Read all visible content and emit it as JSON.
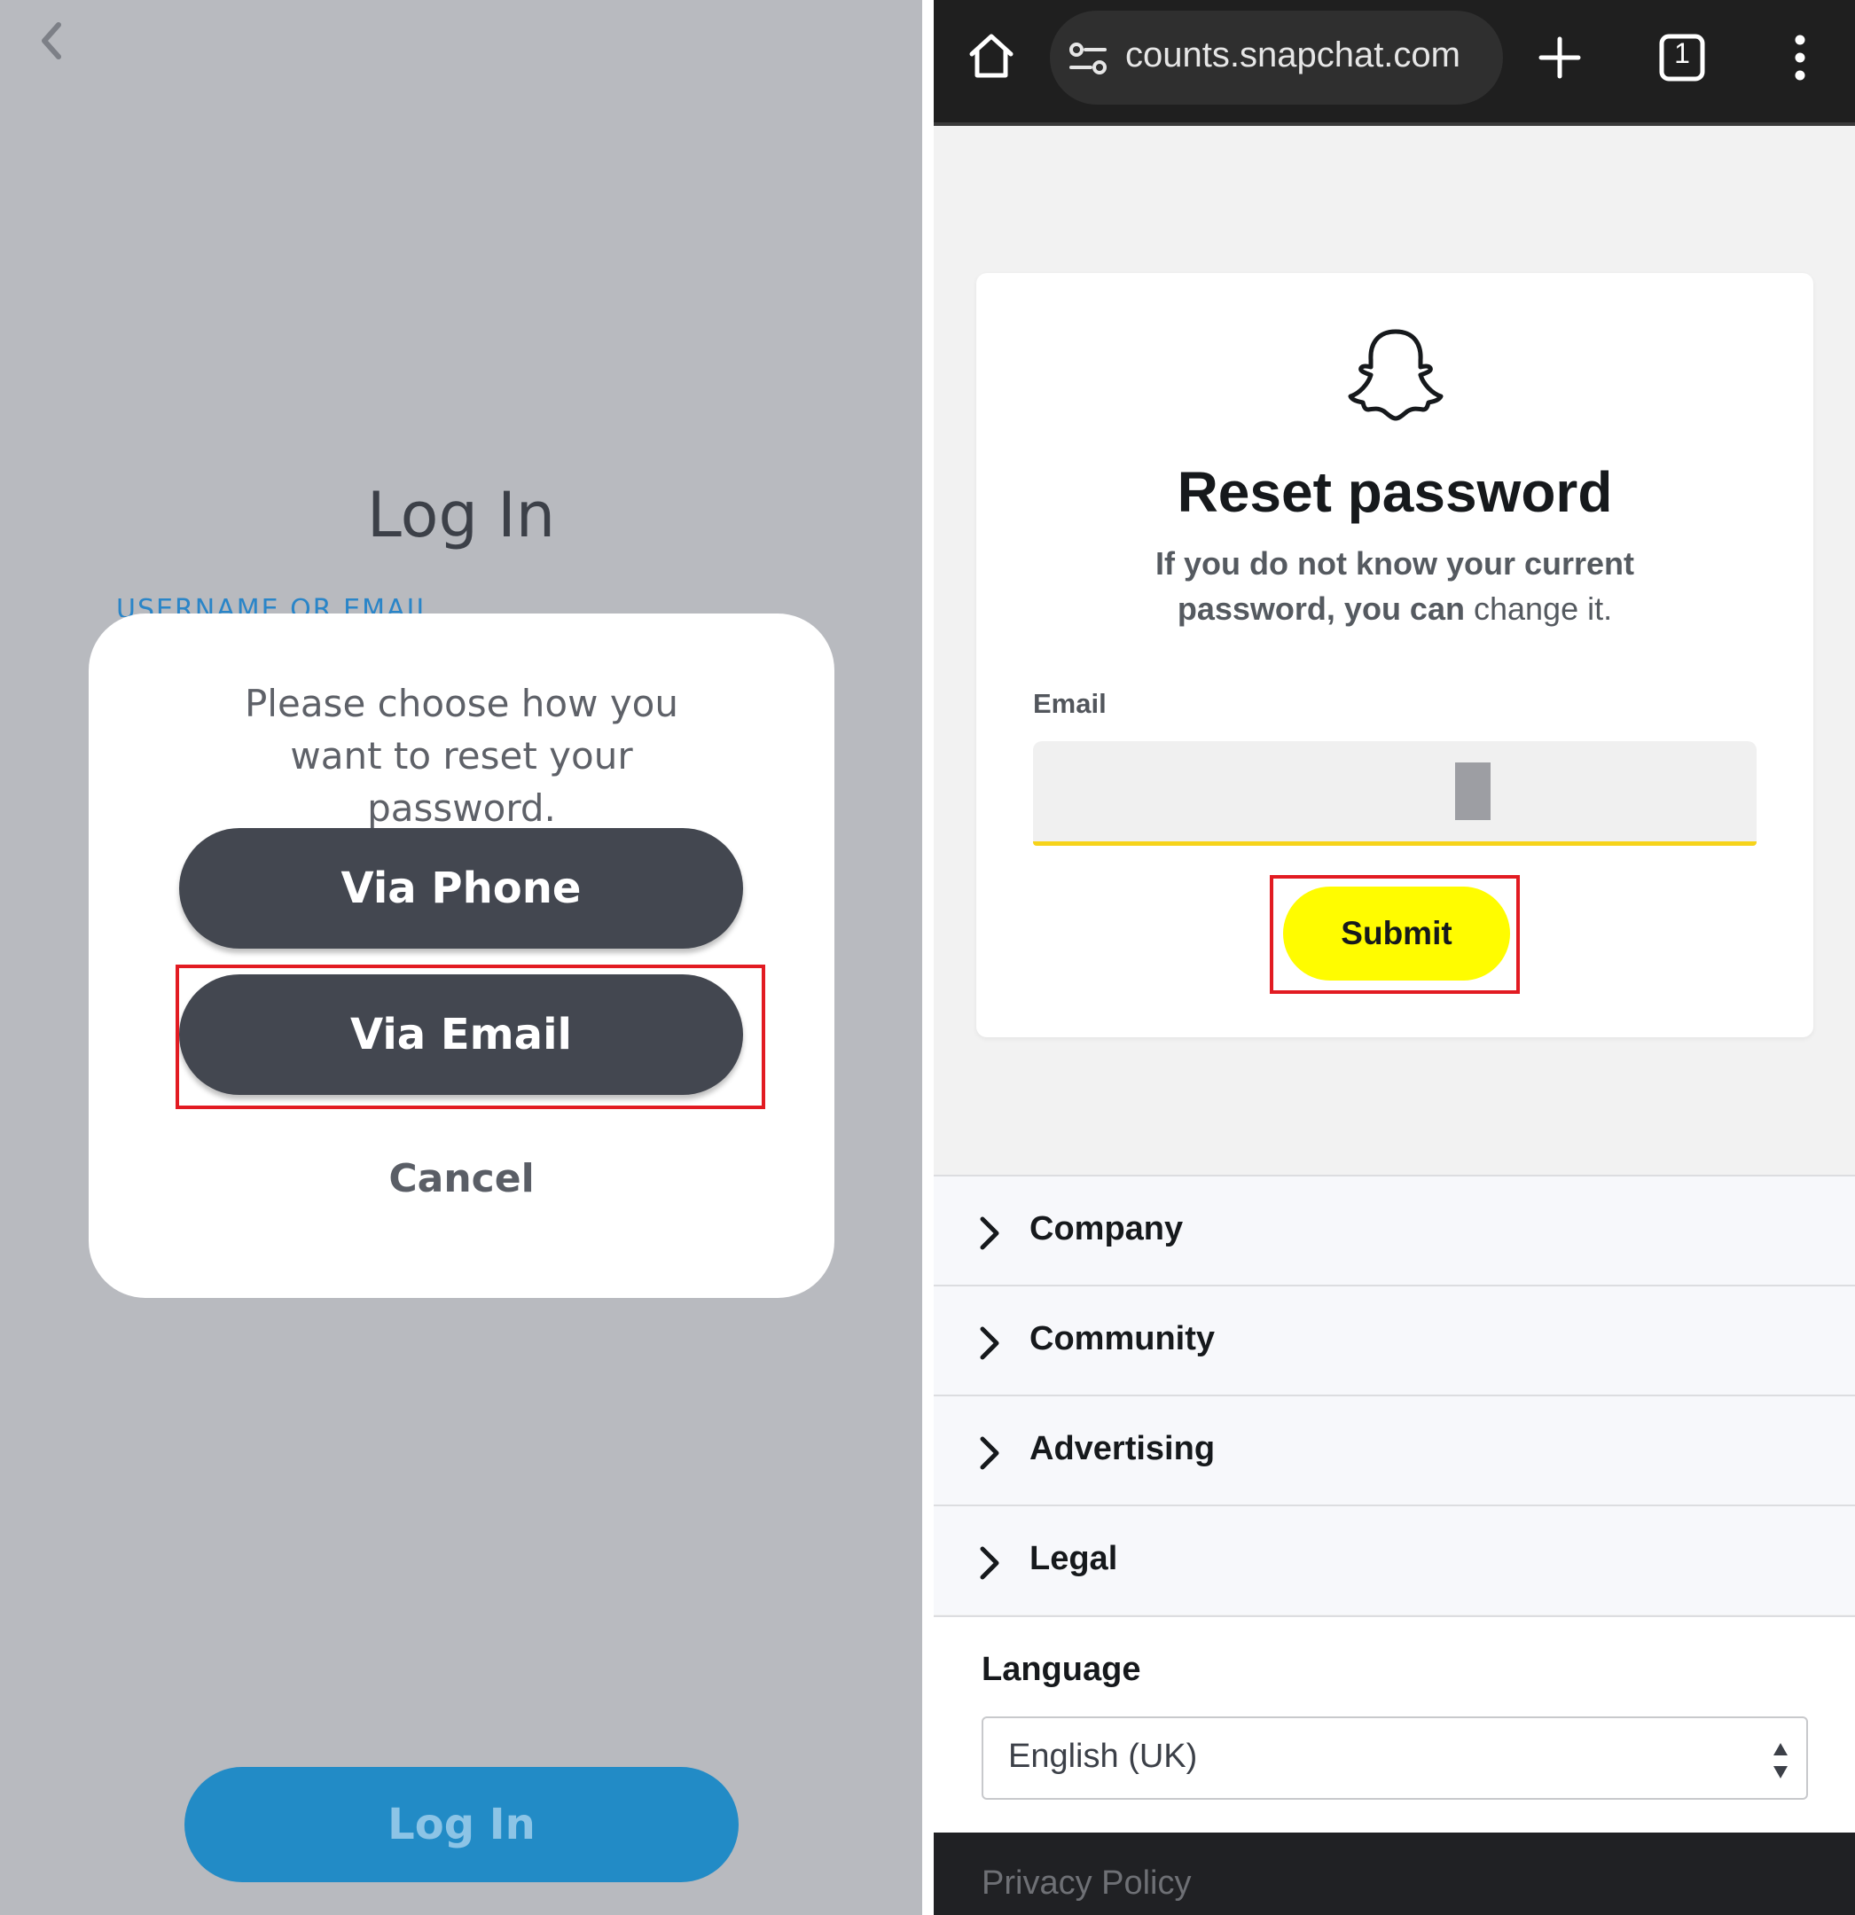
{
  "left_panel": {
    "title": "Log In",
    "username_label": "USERNAME OR EMAIL",
    "modal": {
      "message": "Please choose how you want to reset your password.",
      "via_phone_label": "Via Phone",
      "via_email_label": "Via Email",
      "cancel_label": "Cancel"
    },
    "login_button_label": "Log In"
  },
  "browser": {
    "url": "counts.snapchat.com",
    "tab_count": "1"
  },
  "reset_card": {
    "title": "Reset password",
    "subtitle_bold": "If you do not know your current password, you can",
    "subtitle_link": "change it.",
    "email_label": "Email",
    "email_value": "",
    "submit_label": "Submit"
  },
  "footer": {
    "items": [
      {
        "label": "Company"
      },
      {
        "label": "Community"
      },
      {
        "label": "Advertising"
      },
      {
        "label": "Legal"
      }
    ],
    "language_label": "Language",
    "language_value": "English (UK)",
    "privacy_label": "Privacy Policy"
  },
  "colors": {
    "left_bg": "#b8babf",
    "pill_button": "#434750",
    "login_blue": "#228bc6",
    "snap_yellow": "#fffc00",
    "highlight_red": "#e21b22"
  },
  "icons": [
    "back-icon",
    "home-icon",
    "site-settings-icon",
    "plus-icon",
    "tabs-icon",
    "menu-icon",
    "ghost-logo-icon",
    "chevron-right-icon",
    "select-arrows-icon"
  ]
}
